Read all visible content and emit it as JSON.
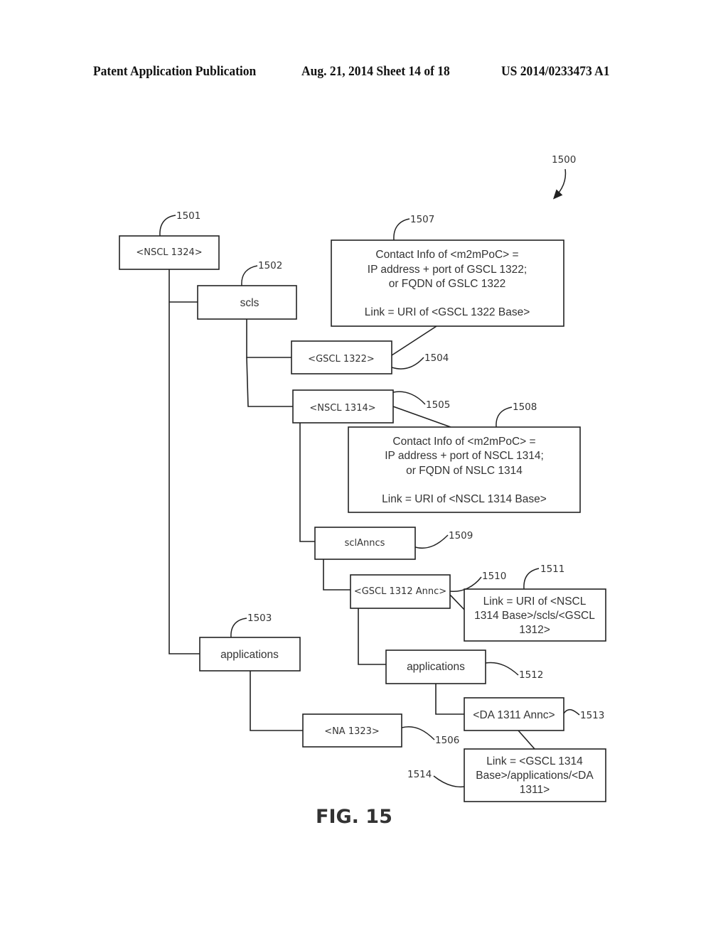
{
  "header": {
    "publication": "Patent Application Publication",
    "date_sheet": "Aug. 21, 2014  Sheet 14 of 18",
    "number": "US 2014/0233473 A1"
  },
  "figure": {
    "label": "FIG. 15",
    "ref": "1500"
  },
  "nodes": {
    "nscl1324": {
      "text": "<NSCL 1324>",
      "ref": "1501"
    },
    "scls": {
      "text": "scls",
      "ref": "1502"
    },
    "applications_top": {
      "text": "applications",
      "ref": "1503"
    },
    "gscl1322": {
      "text": "<GSCL 1322>",
      "ref": "1504"
    },
    "nscl1314": {
      "text": "<NSCL 1314>",
      "ref": "1505"
    },
    "na1323": {
      "text": "<NA 1323>",
      "ref": "1506"
    },
    "sclannncs": {
      "text": "sclAnncs",
      "ref": "1509"
    },
    "gscl1312annc": {
      "text": "<GSCL 1312 Annc>",
      "ref": "1510"
    },
    "applications_sub": {
      "text": "applications",
      "ref": "1512"
    },
    "da1311annc": {
      "text": "<DA 1311 Annc>",
      "ref": "1513"
    }
  },
  "notes": {
    "n1507": {
      "ref": "1507",
      "lines": [
        "Contact Info of <m2mPoC> =",
        "IP address + port of GSCL 1322;",
        "or FQDN of GSLC 1322",
        "",
        "Link = URI of <GSCL 1322 Base>"
      ]
    },
    "n1508": {
      "ref": "1508",
      "lines": [
        "Contact Info of <m2mPoC> =",
        "IP address + port of NSCL 1314;",
        "or FQDN of NSLC 1314",
        "",
        "Link = URI of <NSCL 1314 Base>"
      ]
    },
    "n1511": {
      "ref": "1511",
      "lines": [
        "Link = URI of <NSCL",
        "1314 Base>/scls/<GSCL",
        "1312>"
      ]
    },
    "n1514": {
      "ref": "1514",
      "lines": [
        "Link = <GSCL 1314",
        "Base>/applications/<DA",
        "1311>"
      ]
    }
  }
}
